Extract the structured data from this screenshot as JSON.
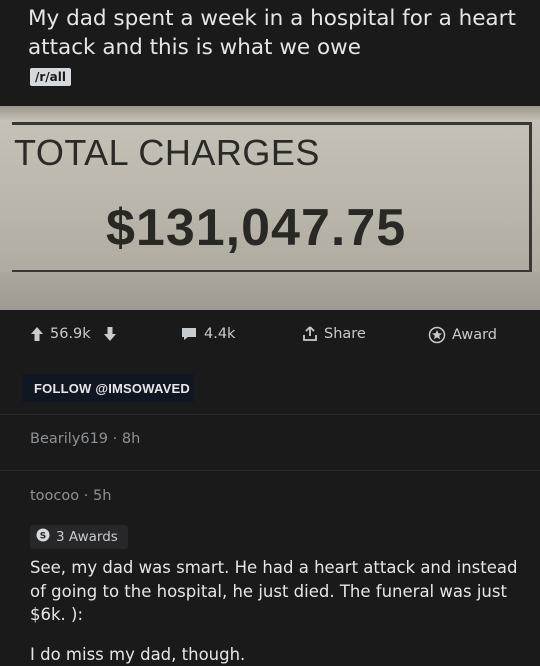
{
  "post": {
    "title": "My dad spent a week in a hospital for a heart attack and this is what we owe",
    "subreddit_tag": "/r/all"
  },
  "image": {
    "label": "TOTAL CHARGES",
    "amount": "$131,047.75"
  },
  "actions": {
    "upvotes": "56.9k",
    "comments": "4.4k",
    "share": "Share",
    "award": "Award"
  },
  "follow_banner": "FOLLOW @IMSOWAVED",
  "comment1": {
    "author": "Bearily619 · 8h"
  },
  "comment2": {
    "author": "toocoo · 5h",
    "awards": "3 Awards",
    "body1": "See, my dad was smart. He had a heart attack and instead of going to the hospital, he just died. The funeral was just $6k. ):",
    "body2": "I do miss my dad, though."
  },
  "colors": {
    "background": "#1a1a1b",
    "text": "#d7dadc",
    "meta": "#8d9194",
    "follow_bg": "#101622"
  }
}
